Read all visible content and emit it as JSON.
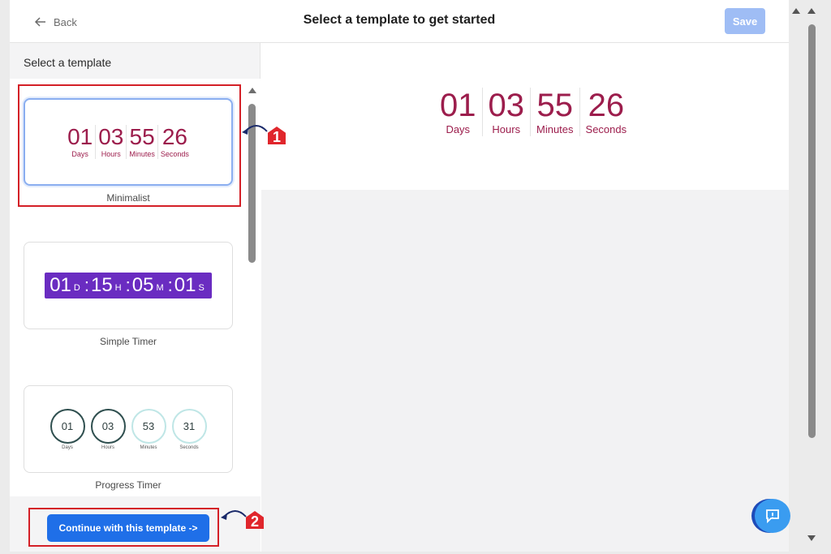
{
  "header": {
    "back_label": "Back",
    "title": "Select a template to get started",
    "save_label": "Save"
  },
  "sidebar": {
    "heading": "Select a template",
    "templates": [
      {
        "name": "Minimalist",
        "units": [
          {
            "num": "01",
            "label": "Days"
          },
          {
            "num": "03",
            "label": "Hours"
          },
          {
            "num": "55",
            "label": "Minutes"
          },
          {
            "num": "26",
            "label": "Seconds"
          }
        ]
      },
      {
        "name": "Simple Timer",
        "units": [
          {
            "num": "01",
            "label": "D"
          },
          {
            "num": "15",
            "label": "H"
          },
          {
            "num": "05",
            "label": "M"
          },
          {
            "num": "01",
            "label": "S"
          }
        ],
        "separator": ":"
      },
      {
        "name": "Progress Timer",
        "units": [
          {
            "num": "01",
            "label": "Days"
          },
          {
            "num": "03",
            "label": "Hours"
          },
          {
            "num": "53",
            "label": "Minutes"
          },
          {
            "num": "31",
            "label": "Seconds"
          }
        ]
      }
    ],
    "continue_label": "Continue with this template ->"
  },
  "preview": {
    "units": [
      {
        "num": "01",
        "label": "Days"
      },
      {
        "num": "03",
        "label": "Hours"
      },
      {
        "num": "55",
        "label": "Minutes"
      },
      {
        "num": "26",
        "label": "Seconds"
      }
    ]
  },
  "annotations": {
    "badge_1": "1",
    "badge_2": "2"
  },
  "colors": {
    "accent": "#1f6fe8",
    "timer_text": "#9c1d4c",
    "simple_timer_bg": "#6a2cc1",
    "annotation": "#d42027"
  },
  "icons": {
    "back": "arrow-left-icon",
    "help": "feedback-icon"
  }
}
